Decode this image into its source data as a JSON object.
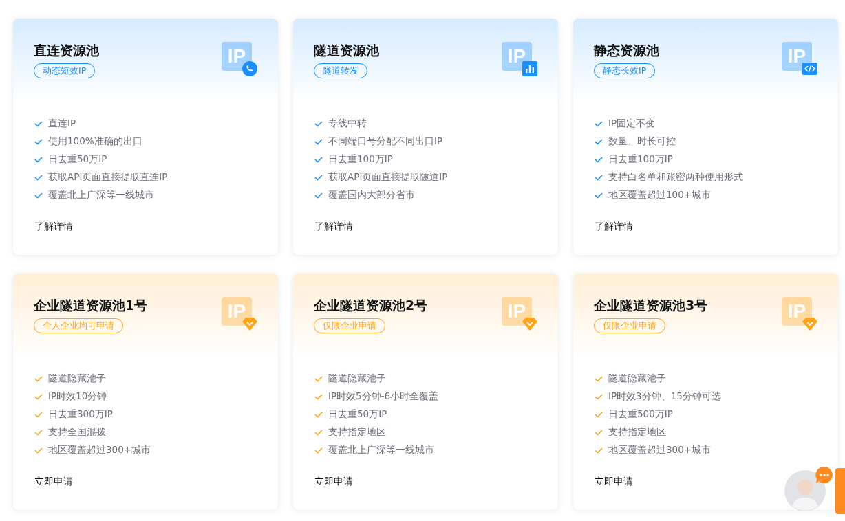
{
  "cards": [
    {
      "title": "直连资源池",
      "tag": "动态短效IP",
      "icon_label": "IP",
      "kind": "phone",
      "color": "#1890ff",
      "features": [
        "直连IP",
        "使用100%准确的出口",
        "日去重50万IP",
        "获取API页面直接提取直连IP",
        "覆盖北上广深等一线城市"
      ],
      "link": "了解详情"
    },
    {
      "title": "隧道资源池",
      "tag": "隧道转发",
      "icon_label": "IP",
      "kind": "chart",
      "color": "#1890ff",
      "features": [
        "专线中转",
        "不同端口号分配不同出口IP",
        "日去重100万IP",
        "获取API页面直接提取隧道IP",
        "覆盖国内大部分省市"
      ],
      "link": "了解详情"
    },
    {
      "title": "静态资源池",
      "tag": "静态长效IP",
      "icon_label": "IP",
      "kind": "code",
      "color": "#1890ff",
      "features": [
        "IP固定不变",
        "数量、时长可控",
        "日去重100万IP",
        "支持白名单和账密两种使用形式",
        "地区覆盖超过100+城市"
      ],
      "link": "了解详情"
    },
    {
      "title": "企业隧道资源池1号",
      "tag": "个人企业均可申请",
      "icon_label": "IP",
      "kind": "gem",
      "color": "#ffa31a",
      "features": [
        "隧道隐藏池子",
        "IP时效10分钟",
        "日去重300万IP",
        "支持全国混拨",
        "地区覆盖超过300+城市"
      ],
      "link": "立即申请"
    },
    {
      "title": "企业隧道资源池2号",
      "tag": "仅限企业申请",
      "icon_label": "IP",
      "kind": "gem",
      "color": "#ffa31a",
      "features": [
        "隧道隐藏池子",
        "IP时效5分钟-6小时全覆盖",
        "日去重50万IP",
        "支持指定地区",
        "覆盖北上广深等一线城市"
      ],
      "link": "立即申请"
    },
    {
      "title": "企业隧道资源池3号",
      "tag": "仅限企业申请",
      "icon_label": "IP",
      "kind": "gem",
      "color": "#ffa31a",
      "features": [
        "隧道隐藏池子",
        "IP时效3分钟、15分钟可选",
        "日去重500万IP",
        "支持指定地区",
        "地区覆盖超过300+城市"
      ],
      "link": "立即申请"
    }
  ]
}
